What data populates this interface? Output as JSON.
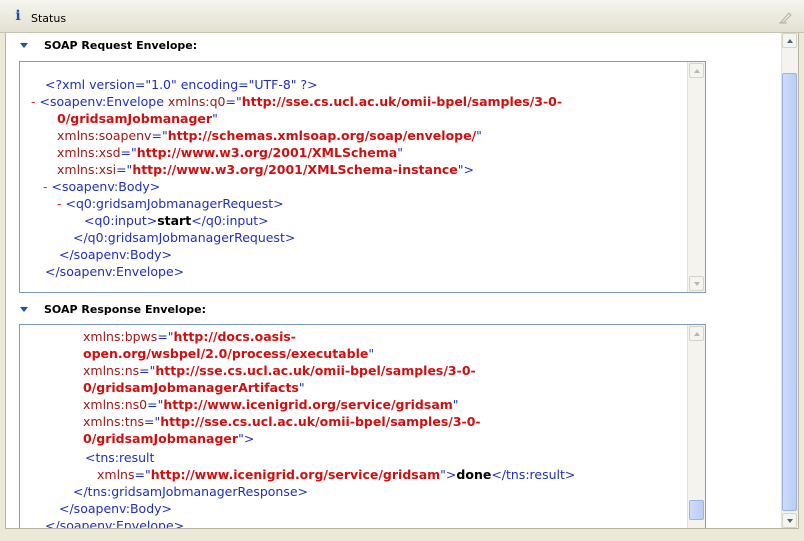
{
  "view": {
    "title": "Status",
    "info_icon": "ⅰ",
    "request": {
      "header": "SOAP Request Envelope:",
      "lines": [
        [
          [
            "tag",
            "<?xml version=\"1.0\" encoding=\"UTF-8\" ?>"
          ]
        ],
        [
          [
            "minus",
            "- "
          ],
          [
            "tag",
            "<soapenv:Envelope "
          ],
          [
            "attr",
            "xmlns:q0"
          ],
          [
            "tag",
            "=\""
          ],
          [
            "val",
            "http://sse.cs.ucl.ac.uk/omii-bpel/samples/3-0-"
          ]
        ],
        [
          [
            "val",
            "0/gridsamJobmanager"
          ],
          [
            "tag",
            "\""
          ]
        ],
        [
          [
            "attr",
            "xmlns:soapenv"
          ],
          [
            "tag",
            "=\""
          ],
          [
            "val",
            "http://schemas.xmlsoap.org/soap/envelope/"
          ],
          [
            "tag",
            "\""
          ]
        ],
        [
          [
            "attr",
            "xmlns:xsd"
          ],
          [
            "tag",
            "=\""
          ],
          [
            "val",
            "http://www.w3.org/2001/XMLSchema"
          ],
          [
            "tag",
            "\""
          ]
        ],
        [
          [
            "attr",
            "xmlns:xsi"
          ],
          [
            "tag",
            "=\""
          ],
          [
            "val",
            "http://www.w3.org/2001/XMLSchema-instance"
          ],
          [
            "tag",
            "\">"
          ]
        ],
        [
          [
            "minus",
            "- "
          ],
          [
            "tag",
            "<soapenv:Body>"
          ]
        ],
        [
          [
            "minus",
            "- "
          ],
          [
            "tag",
            "<q0:gridsamJobmanagerRequest>"
          ]
        ],
        [
          [
            "tag",
            "<q0:input>"
          ],
          [
            "txt",
            "start"
          ],
          [
            "tag",
            "</q0:input>"
          ]
        ],
        [
          [
            "tag",
            "</q0:gridsamJobmanagerRequest>"
          ]
        ],
        [
          [
            "tag",
            "</soapenv:Body>"
          ]
        ],
        [
          [
            "tag",
            "</soapenv:Envelope>"
          ]
        ]
      ]
    },
    "response": {
      "header": "SOAP Response Envelope:",
      "lines": [
        [
          [
            "attr",
            "xmlns:bpws"
          ],
          [
            "tag",
            "=\""
          ],
          [
            "val",
            "http://docs.oasis-"
          ]
        ],
        [
          [
            "val",
            "open.org/wsbpel/2.0/process/executable"
          ],
          [
            "tag",
            "\""
          ]
        ],
        [
          [
            "attr",
            "xmlns:ns"
          ],
          [
            "tag",
            "=\""
          ],
          [
            "val",
            "http://sse.cs.ucl.ac.uk/omii-bpel/samples/3-0-"
          ]
        ],
        [
          [
            "val",
            "0/gridsamJobmanagerArtifacts"
          ],
          [
            "tag",
            "\""
          ]
        ],
        [
          [
            "attr",
            "xmlns:ns0"
          ],
          [
            "tag",
            "=\""
          ],
          [
            "val",
            "http://www.icenigrid.org/service/gridsam"
          ],
          [
            "tag",
            "\""
          ]
        ],
        [
          [
            "attr",
            "xmlns:tns"
          ],
          [
            "tag",
            "=\""
          ],
          [
            "val",
            "http://sse.cs.ucl.ac.uk/omii-bpel/samples/3-0-"
          ]
        ],
        [
          [
            "val",
            "0/gridsamJobmanager"
          ],
          [
            "tag",
            "\">"
          ]
        ],
        [
          [
            "tag",
            "<tns:result"
          ]
        ],
        [
          [
            "attr",
            "xmlns"
          ],
          [
            "tag",
            "=\""
          ],
          [
            "val",
            "http://www.icenigrid.org/service/gridsam"
          ],
          [
            "tag",
            "\">"
          ],
          [
            "txt",
            "done"
          ],
          [
            "tag",
            "</tns:result>"
          ]
        ],
        [
          [
            "tag",
            "</tns:gridsamJobmanagerResponse>"
          ]
        ],
        [
          [
            "tag",
            "</soapenv:Body>"
          ]
        ],
        [
          [
            "tag",
            "</soapenv:Envelope>"
          ]
        ]
      ]
    }
  }
}
